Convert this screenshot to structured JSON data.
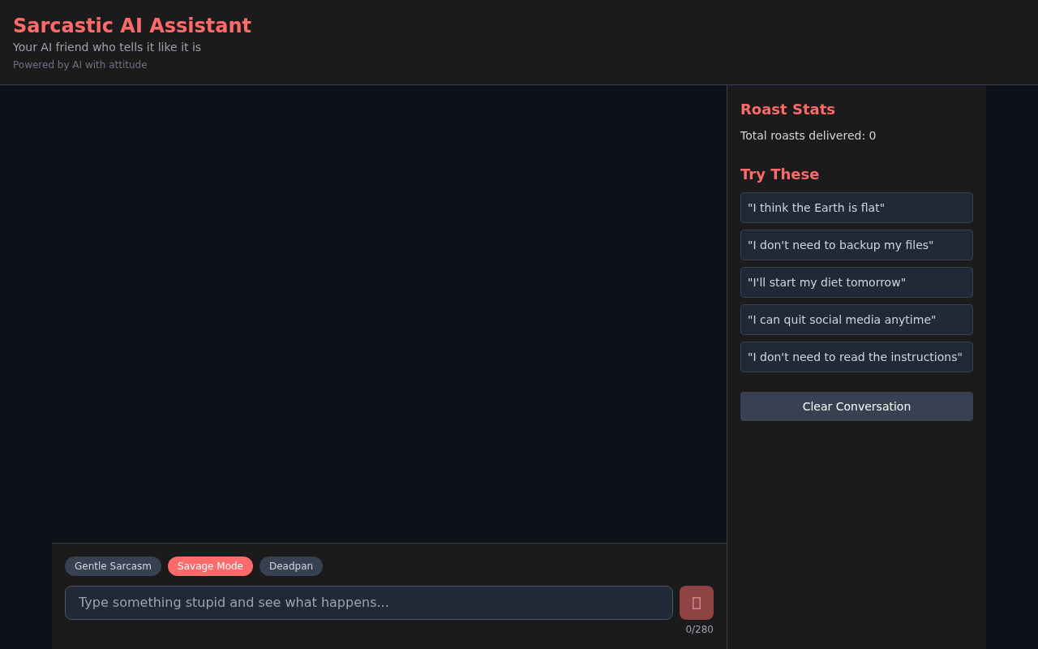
{
  "header": {
    "title": "Sarcastic AI Assistant",
    "subtitle": "Your AI friend who tells it like it is",
    "tagline": "Powered by AI with attitude"
  },
  "composer": {
    "modes": [
      {
        "label": "Gentle Sarcasm",
        "selected": false
      },
      {
        "label": "Savage Mode",
        "selected": true
      },
      {
        "label": "Deadpan",
        "selected": false
      }
    ],
    "input": {
      "placeholder": "Type something stupid and see what happens..."
    },
    "send_button": {
      "disabled": true
    },
    "char_count": "0/280"
  },
  "sidebar": {
    "stats": {
      "title": "Roast Stats",
      "total": "Total roasts delivered: 0"
    },
    "suggestions": {
      "title": "Try These",
      "items": [
        "\"I think the Earth is flat\"",
        "\"I don't need to backup my files\"",
        "\"I'll start my diet tomorrow\"",
        "\"I can quit social media anytime\"",
        "\"I don't need to read the instructions\""
      ]
    },
    "clear_button": "Clear Conversation"
  }
}
